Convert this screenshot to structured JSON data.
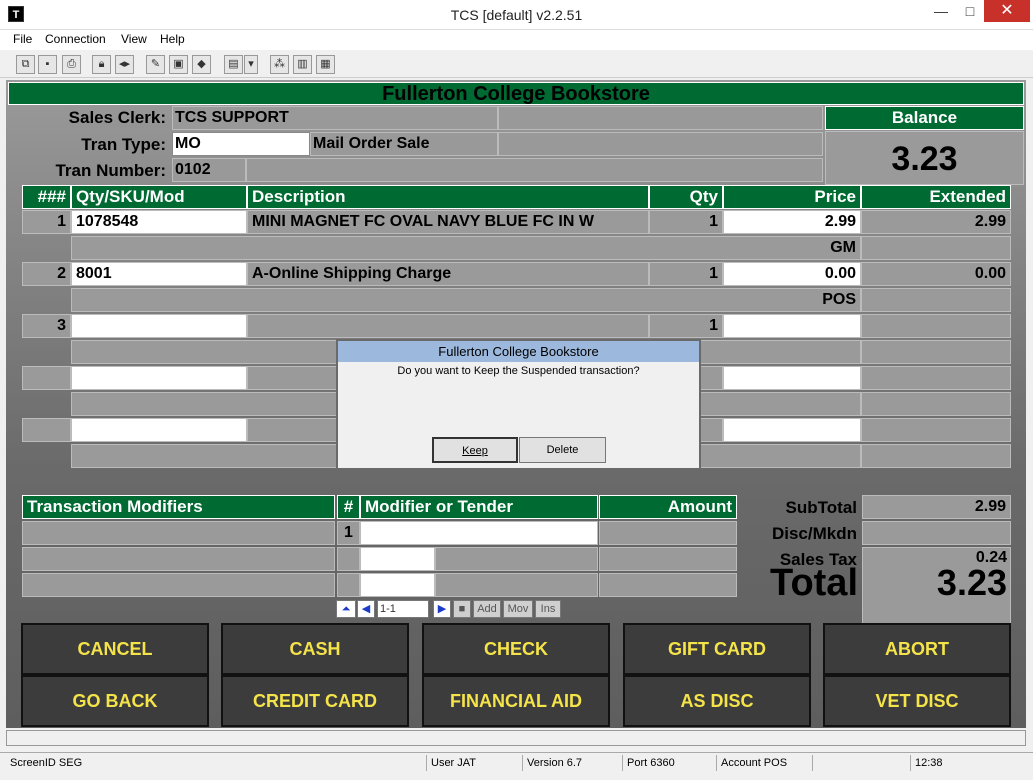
{
  "window": {
    "title": "TCS [default]  v2.2.51",
    "icon": "T",
    "min": "—",
    "max": "□",
    "close": "✕"
  },
  "menu": [
    "File",
    "Connection",
    "View",
    "Help"
  ],
  "toolbar_icons": [
    "copy-icon",
    "save-icon",
    "print-icon",
    "lock-icon",
    "volume-icon",
    "config-icon",
    "monitor-icon",
    "book-icon",
    "receipt-icon",
    "dropdown-icon",
    "network-icon",
    "chart-icon",
    "calculator-icon"
  ],
  "header": {
    "store": "Fullerton College Bookstore"
  },
  "info": {
    "clerk_label": "Sales Clerk:",
    "clerk": "TCS SUPPORT",
    "tran_type_label": "Tran Type:",
    "tran_type": "MO",
    "tran_type_desc": "Mail Order Sale",
    "tran_number_label": "Tran Number:",
    "tran_number": "0102",
    "balance_label": "Balance",
    "balance": "3.23"
  },
  "grid_headers": {
    "num": "###",
    "sku": "Qty/SKU/Mod",
    "desc": "Description",
    "qty": "Qty",
    "price": "Price",
    "ext": "Extended"
  },
  "lines": [
    {
      "num": "1",
      "sku": "1078548",
      "desc": "MINI MAGNET FC OVAL NAVY BLUE FC IN W",
      "qty": "1",
      "price": "2.99",
      "ext": "2.99",
      "sub": "GM"
    },
    {
      "num": "2",
      "sku": "8001",
      "desc": "A-Online Shipping Charge",
      "qty": "1",
      "price": "0.00",
      "ext": "0.00",
      "sub": "POS"
    },
    {
      "num": "3",
      "sku": "",
      "desc": "",
      "qty": "1",
      "price": "",
      "ext": "",
      "sub": ""
    }
  ],
  "modifiers": {
    "title": "Transaction Modifiers",
    "num_header": "#",
    "tender_header": "Modifier or Tender",
    "amount_header": "Amount",
    "row_num": "1"
  },
  "nav": {
    "position": "1-1",
    "add": "Add",
    "mov": "Mov",
    "ins": "Ins"
  },
  "totals": {
    "subtotal_label": "SubTotal",
    "subtotal": "2.99",
    "disc_label": "Disc/Mkdn",
    "disc": "",
    "tax_label": "Sales Tax",
    "tax": "0.24",
    "total_label": "Total",
    "total": "3.23"
  },
  "buttons": [
    [
      "CANCEL",
      "CASH",
      "CHECK",
      "GIFT CARD",
      "ABORT"
    ],
    [
      "GO BACK",
      "CREDIT CARD",
      "FINANCIAL AID",
      "AS DISC",
      "VET DISC"
    ]
  ],
  "dialog": {
    "title": "Fullerton College Bookstore",
    "message": "Do you want to Keep the Suspended transaction?",
    "keep": "Keep",
    "delete": "Delete"
  },
  "status": {
    "screen": "ScreenID SEG",
    "user": "User JAT",
    "version": "Version 6.7",
    "port": "Port 6360",
    "account": "Account POS",
    "time": "12:38"
  }
}
